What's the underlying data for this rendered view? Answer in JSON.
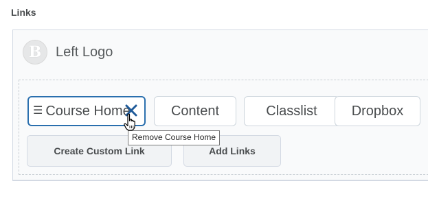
{
  "section": {
    "label": "Links"
  },
  "logo": {
    "letter": "B",
    "text": "Left Logo"
  },
  "links": [
    {
      "label": "Course Home",
      "state": "focused"
    },
    {
      "label": "Content"
    },
    {
      "label": "Classlist"
    },
    {
      "label": "Dropbox"
    }
  ],
  "actions": {
    "create_custom_link": "Create Custom Link",
    "add_links": "Add Links"
  },
  "tooltip": {
    "text": "Remove Course Home"
  },
  "icons": {
    "drag_handle": "drag-handle-icon",
    "remove": "close-icon",
    "cursor": "hand-pointer-icon"
  },
  "colors": {
    "focus_border": "#2a6fae",
    "remove_icon": "#1e5a99",
    "button_bg": "#f1f3f5"
  }
}
